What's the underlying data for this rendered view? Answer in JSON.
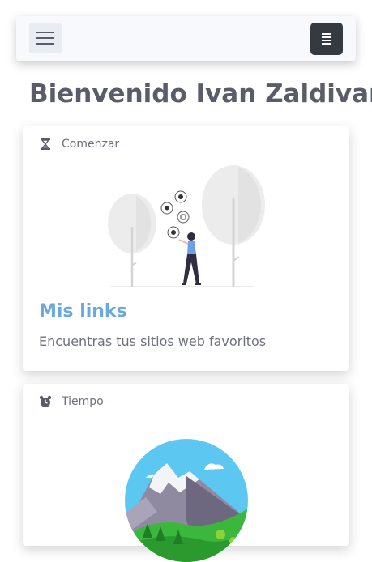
{
  "heading": "Bienvenido Ivan Zaldivar",
  "cards": [
    {
      "header": "Comenzar",
      "header_icon": "hourglass-icon",
      "title": "Mis links",
      "text": "Encuentras tus sitios web favoritos"
    },
    {
      "header": "Tiempo",
      "header_icon": "alarm-clock-icon"
    }
  ],
  "colors": {
    "link_title": "#6aa9e0",
    "dark_button": "#343a40",
    "text": "#5a5c69"
  }
}
